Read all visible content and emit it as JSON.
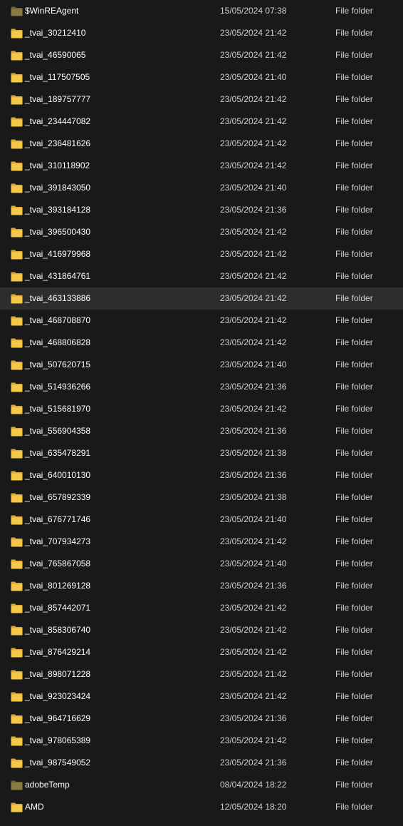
{
  "colors": {
    "background": "#191919",
    "hover_row": "#2d2d2d",
    "folder_yellow": "#f4c84b",
    "folder_yellow_back": "#dba935",
    "folder_hidden": "#8a7a44",
    "folder_hidden_back": "#6f6235"
  },
  "rows": [
    {
      "name": "$WinREAgent",
      "date": "15/05/2024 07:38",
      "type": "File folder",
      "icon": "hidden-folder-icon",
      "hidden": true
    },
    {
      "name": "_tvai_30212410",
      "date": "23/05/2024 21:42",
      "type": "File folder",
      "icon": "folder-icon"
    },
    {
      "name": "_tvai_46590065",
      "date": "23/05/2024 21:42",
      "type": "File folder",
      "icon": "folder-icon"
    },
    {
      "name": "_tvai_117507505",
      "date": "23/05/2024 21:40",
      "type": "File folder",
      "icon": "folder-icon"
    },
    {
      "name": "_tvai_189757777",
      "date": "23/05/2024 21:42",
      "type": "File folder",
      "icon": "folder-icon"
    },
    {
      "name": "_tvai_234447082",
      "date": "23/05/2024 21:42",
      "type": "File folder",
      "icon": "folder-icon"
    },
    {
      "name": "_tvai_236481626",
      "date": "23/05/2024 21:42",
      "type": "File folder",
      "icon": "folder-icon"
    },
    {
      "name": "_tvai_310118902",
      "date": "23/05/2024 21:42",
      "type": "File folder",
      "icon": "folder-icon"
    },
    {
      "name": "_tvai_391843050",
      "date": "23/05/2024 21:40",
      "type": "File folder",
      "icon": "folder-icon"
    },
    {
      "name": "_tvai_393184128",
      "date": "23/05/2024 21:36",
      "type": "File folder",
      "icon": "folder-icon"
    },
    {
      "name": "_tvai_396500430",
      "date": "23/05/2024 21:42",
      "type": "File folder",
      "icon": "folder-icon"
    },
    {
      "name": "_tvai_416979968",
      "date": "23/05/2024 21:42",
      "type": "File folder",
      "icon": "folder-icon"
    },
    {
      "name": "_tvai_431864761",
      "date": "23/05/2024 21:42",
      "type": "File folder",
      "icon": "folder-icon"
    },
    {
      "name": "_tvai_463133886",
      "date": "23/05/2024 21:42",
      "type": "File folder",
      "icon": "folder-icon",
      "hover": true
    },
    {
      "name": "_tvai_468708870",
      "date": "23/05/2024 21:42",
      "type": "File folder",
      "icon": "folder-icon"
    },
    {
      "name": "_tvai_468806828",
      "date": "23/05/2024 21:42",
      "type": "File folder",
      "icon": "folder-icon"
    },
    {
      "name": "_tvai_507620715",
      "date": "23/05/2024 21:40",
      "type": "File folder",
      "icon": "folder-icon"
    },
    {
      "name": "_tvai_514936266",
      "date": "23/05/2024 21:36",
      "type": "File folder",
      "icon": "folder-icon"
    },
    {
      "name": "_tvai_515681970",
      "date": "23/05/2024 21:42",
      "type": "File folder",
      "icon": "folder-icon"
    },
    {
      "name": "_tvai_556904358",
      "date": "23/05/2024 21:36",
      "type": "File folder",
      "icon": "folder-icon"
    },
    {
      "name": "_tvai_635478291",
      "date": "23/05/2024 21:38",
      "type": "File folder",
      "icon": "folder-icon"
    },
    {
      "name": "_tvai_640010130",
      "date": "23/05/2024 21:36",
      "type": "File folder",
      "icon": "folder-icon"
    },
    {
      "name": "_tvai_657892339",
      "date": "23/05/2024 21:38",
      "type": "File folder",
      "icon": "folder-icon"
    },
    {
      "name": "_tvai_676771746",
      "date": "23/05/2024 21:40",
      "type": "File folder",
      "icon": "folder-icon"
    },
    {
      "name": "_tvai_707934273",
      "date": "23/05/2024 21:42",
      "type": "File folder",
      "icon": "folder-icon"
    },
    {
      "name": "_tvai_765867058",
      "date": "23/05/2024 21:40",
      "type": "File folder",
      "icon": "folder-icon"
    },
    {
      "name": "_tvai_801269128",
      "date": "23/05/2024 21:36",
      "type": "File folder",
      "icon": "folder-icon"
    },
    {
      "name": "_tvai_857442071",
      "date": "23/05/2024 21:42",
      "type": "File folder",
      "icon": "folder-icon"
    },
    {
      "name": "_tvai_858306740",
      "date": "23/05/2024 21:42",
      "type": "File folder",
      "icon": "folder-icon"
    },
    {
      "name": "_tvai_876429214",
      "date": "23/05/2024 21:42",
      "type": "File folder",
      "icon": "folder-icon"
    },
    {
      "name": "_tvai_898071228",
      "date": "23/05/2024 21:42",
      "type": "File folder",
      "icon": "folder-icon"
    },
    {
      "name": "_tvai_923023424",
      "date": "23/05/2024 21:42",
      "type": "File folder",
      "icon": "folder-icon"
    },
    {
      "name": "_tvai_964716629",
      "date": "23/05/2024 21:36",
      "type": "File folder",
      "icon": "folder-icon"
    },
    {
      "name": "_tvai_978065389",
      "date": "23/05/2024 21:42",
      "type": "File folder",
      "icon": "folder-icon"
    },
    {
      "name": "_tvai_987549052",
      "date": "23/05/2024 21:36",
      "type": "File folder",
      "icon": "folder-icon"
    },
    {
      "name": "adobeTemp",
      "date": "08/04/2024 18:22",
      "type": "File folder",
      "icon": "hidden-folder-icon",
      "hidden": true
    },
    {
      "name": "AMD",
      "date": "12/05/2024 18:20",
      "type": "File folder",
      "icon": "folder-icon"
    }
  ]
}
